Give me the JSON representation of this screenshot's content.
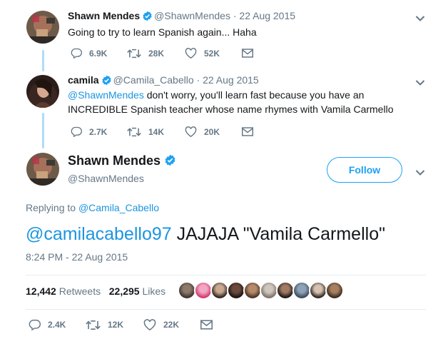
{
  "reply_1": {
    "name": "Shawn Mendes",
    "handle": "@ShawnMendes",
    "date": "· 22 Aug 2015",
    "text": "Going to try to learn Spanish again... Haha",
    "replies": "6.9K",
    "retweets": "28K",
    "likes": "52K"
  },
  "reply_2": {
    "name": "camila",
    "handle": "@Camila_Cabello",
    "date": "· 22 Aug 2015",
    "mention": "@ShawnMendes",
    "text": " don't worry, you'll learn fast because you have an INCREDIBLE Spanish teacher whose name rhymes with Vamila Carmello",
    "replies": "2.7K",
    "retweets": "14K",
    "likes": "20K"
  },
  "main": {
    "name": "Shawn Mendes",
    "handle": "@ShawnMendes",
    "follow_label": "Follow",
    "replying_prefix": "Replying to ",
    "replying_to": "@Camila_Cabello",
    "mention": "@camilacabello97",
    "text": " JAJAJA \"Vamila Carmello\"",
    "timestamp": "8:24 PM - 22 Aug 2015",
    "retweet_count": "12,442",
    "retweet_label": "Retweets",
    "like_count": "22,295",
    "like_label": "Likes",
    "replies": "2.4K",
    "retweets": "12K",
    "likes": "22K"
  },
  "colors": {
    "accent": "#1da1f2",
    "link": "#1b95e0",
    "muted": "#657786",
    "thread_line": "#aeddf9"
  },
  "icons": [
    "verified-icon",
    "chevron-down-icon",
    "reply-icon",
    "retweet-icon",
    "like-icon",
    "message-icon"
  ]
}
